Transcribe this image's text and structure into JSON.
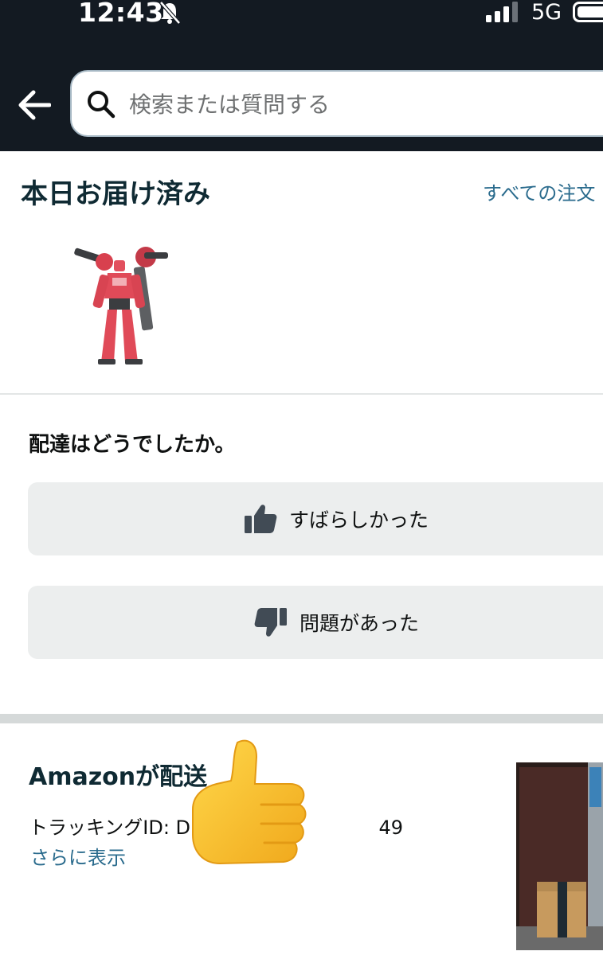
{
  "status_bar": {
    "time": "12:43",
    "network": "5G"
  },
  "header": {
    "search_placeholder": "検索または質問する"
  },
  "delivered": {
    "title": "本日お届け済み",
    "all_orders_link": "すべての注文"
  },
  "feedback": {
    "question": "配達はどうでしたか。",
    "great_label": "すばらしかった",
    "problem_label": "問題があった"
  },
  "shipment": {
    "carrier": "Amazonが配送",
    "tracking": "トラッキングID: D                               49",
    "show_more": "さらに表示"
  },
  "colors": {
    "header_bg": "#131a22",
    "link": "#2a6b8d",
    "button_bg": "#eceeee"
  }
}
